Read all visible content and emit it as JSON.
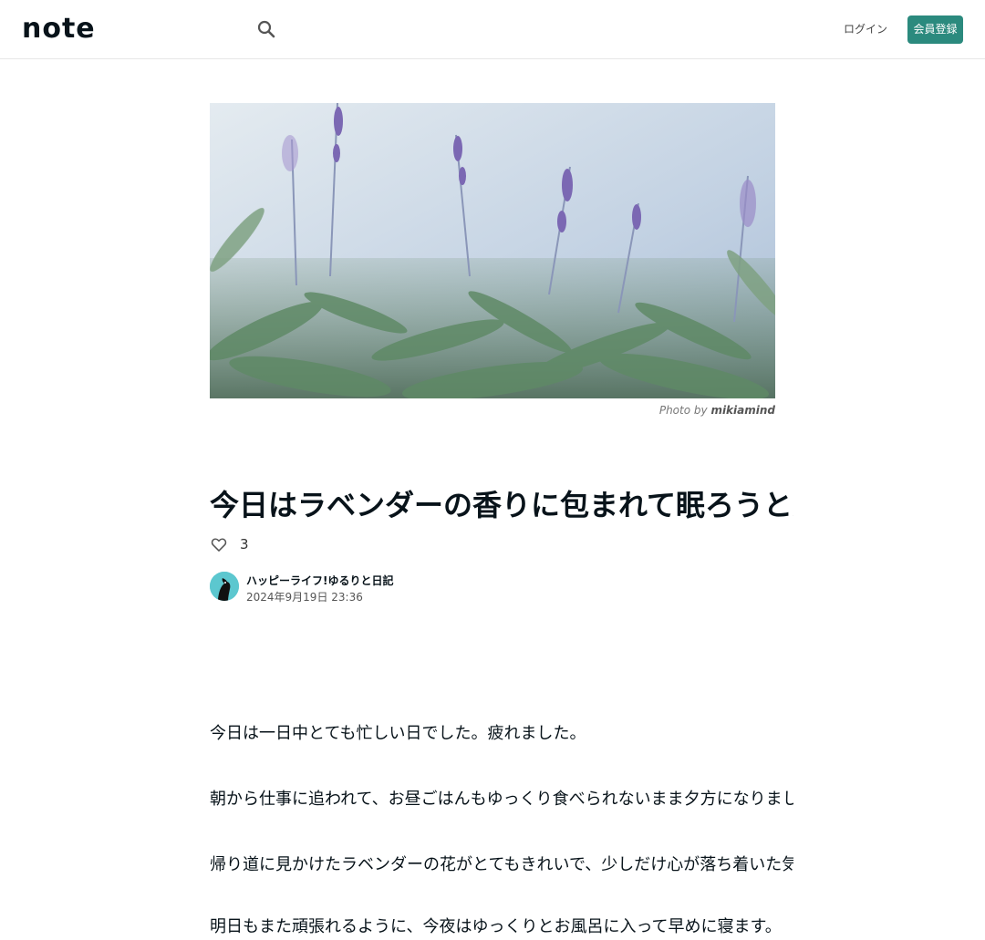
{
  "header": {
    "logo": "note",
    "search_icon": "search-icon",
    "login_label": "ログイン",
    "signup_label": "会員登録"
  },
  "hero": {
    "photo_by_label": "Photo by",
    "photo_author": "mikiamind"
  },
  "article": {
    "title": "今日はラベンダーの香りに包まれて眠ろうと思います",
    "like_count": "3",
    "author_name": "ハッピーライフ!ゆるりと日記",
    "date": "2024年9月19日 23:36",
    "paragraphs": [
      "今日は一日中とても忙しい日でした。疲れました。",
      "朝から仕事に追われて、お昼ごはんもゆっくり食べられないまま夕方になりました。",
      "帰り道に見かけたラベンダーの花がとてもきれいで、少しだけ心が落ち着いた気がします。",
      "明日もまた頑張れるように、今夜はゆっくりとお風呂に入って早めに寝ます。"
    ]
  },
  "colors": {
    "accent": "#2b8a7e",
    "text": "#08131a",
    "avatar_bg": "#5cc7cf"
  }
}
